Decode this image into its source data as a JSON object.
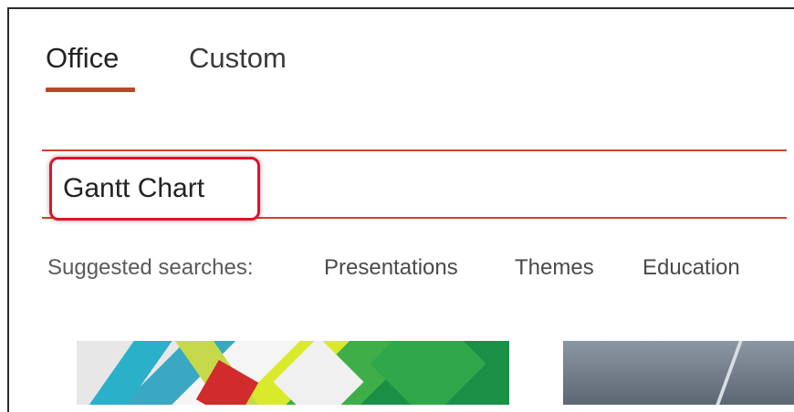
{
  "tabs": [
    {
      "label": "Office",
      "active": true
    },
    {
      "label": "Custom",
      "active": false
    }
  ],
  "search": {
    "value": "Gantt Chart",
    "placeholder": ""
  },
  "suggested": {
    "label": "Suggested searches:",
    "items": [
      "Presentations",
      "Themes",
      "Education"
    ]
  },
  "colors": {
    "accent": "#b7472a",
    "highlight_border": "#e4112a"
  }
}
